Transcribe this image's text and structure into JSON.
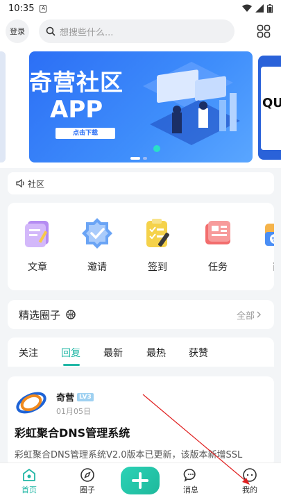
{
  "status_bar": {
    "time": "10:35",
    "sim_label": "A"
  },
  "top_bar": {
    "login_label": "登录",
    "search_placeholder": "想搜些什么..."
  },
  "banner": {
    "title": "奇营社区",
    "subtitle": "APP",
    "button_label": "点击下载",
    "next_banner_text": "QU"
  },
  "notice": {
    "text": "社区"
  },
  "menu": [
    {
      "label": "文章",
      "icon": "article-icon"
    },
    {
      "label": "邀请",
      "icon": "invite-icon"
    },
    {
      "label": "签到",
      "icon": "checkin-icon"
    },
    {
      "label": "任务",
      "icon": "task-icon"
    },
    {
      "label": "商",
      "icon": "shop-icon"
    }
  ],
  "circles": {
    "title": "精选圈子",
    "all_label": "全部"
  },
  "tabs": [
    {
      "label": "关注"
    },
    {
      "label": "回复",
      "active": true
    },
    {
      "label": "最新"
    },
    {
      "label": "最热"
    },
    {
      "label": "获赞"
    }
  ],
  "post": {
    "author": "奇营",
    "level": "LV3",
    "date": "01月05日",
    "title": "彩虹聚合DNS管理系统",
    "excerpt": "彩虹聚合DNS管理系统V2.0版本已更新，该版本新增SSL"
  },
  "bottom_nav": [
    {
      "label": "首页",
      "active": true
    },
    {
      "label": "圈子"
    },
    {
      "label": "消息"
    },
    {
      "label": "我的"
    }
  ],
  "colors": {
    "accent": "#22b7a6",
    "banner_blue": "#2c6ff5",
    "annotation_red": "#e02020"
  }
}
